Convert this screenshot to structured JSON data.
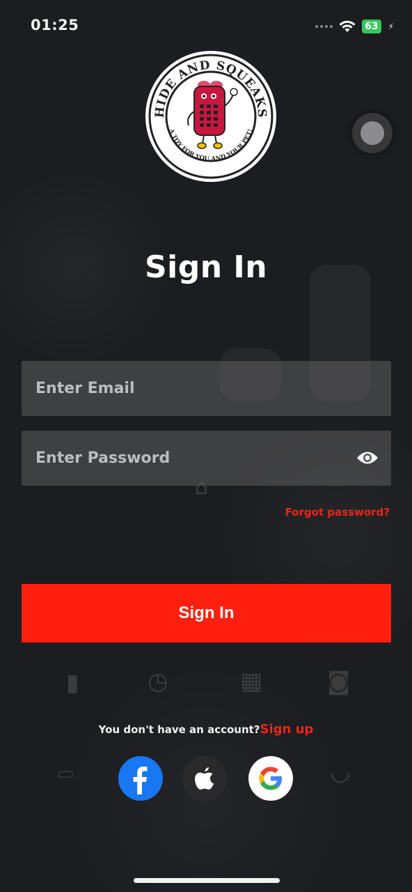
{
  "status_bar": {
    "time": "01:25",
    "battery": "63"
  },
  "logo": {
    "top_text": "HIDE AND SQUEAKS",
    "bottom_text": "A TOY FOR YOU AND YOUR PET!"
  },
  "form": {
    "title": "Sign In",
    "email_placeholder": "Enter Email",
    "password_placeholder": "Enter Password",
    "forgot_label": "Forgot password?",
    "submit_label": "Sign In"
  },
  "footer": {
    "account_prompt": "You don't have an account?",
    "signup_label": "Sign up"
  },
  "social": {
    "facebook_icon": "facebook-icon",
    "apple_icon": "apple-icon",
    "google_icon": "google-icon"
  },
  "colors": {
    "accent": "#ff1f0e",
    "background": "#1c1d20",
    "field": "#4a4a4d"
  }
}
